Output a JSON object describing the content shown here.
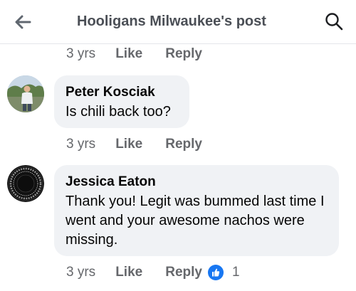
{
  "header": {
    "title": "Hooligans Milwaukee's post",
    "back_icon": "arrow-left-icon",
    "search_icon": "search-icon"
  },
  "top_actions": {
    "time": "3 yrs",
    "like": "Like",
    "reply": "Reply"
  },
  "comments": [
    {
      "author": "Peter Kosciak",
      "text": "Is chili back too?",
      "time": "3 yrs",
      "like": "Like",
      "reply": "Reply"
    },
    {
      "author": "Jessica Eaton",
      "text": "Thank you! Legit was bummed last time I went and your awesome nachos were missing.",
      "time": "3 yrs",
      "like": "Like",
      "reply": "Reply",
      "reaction_icon": "like-reaction-icon",
      "reaction_count": "1"
    }
  ],
  "colors": {
    "bubble": "#f0f2f5",
    "meta_text": "#65676b",
    "like_reaction": "#1877f2"
  }
}
